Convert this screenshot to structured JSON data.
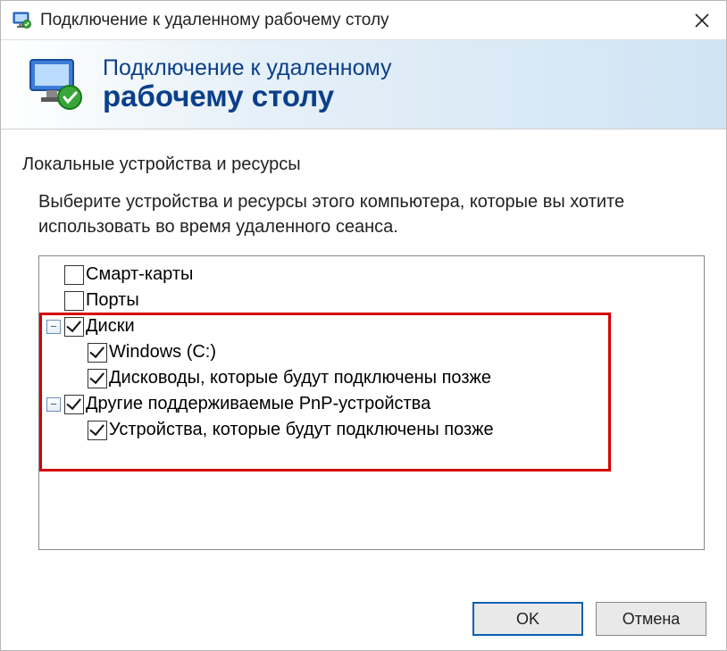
{
  "titlebar": {
    "title": "Подключение к удаленному рабочему столу"
  },
  "banner": {
    "line1": "Подключение к удаленному",
    "line2": "рабочему столу"
  },
  "section": {
    "title": "Локальные устройства и ресурсы",
    "desc": "Выберите устройства и ресурсы этого компьютера, которые вы хотите использовать во время удаленного сеанса."
  },
  "tree": {
    "items": [
      {
        "label": "Смарт-карты",
        "checked": false,
        "level": 1,
        "expander": null
      },
      {
        "label": "Порты",
        "checked": false,
        "level": 1,
        "expander": null
      },
      {
        "label": "Диски",
        "checked": true,
        "level": 1,
        "expander": "minus"
      },
      {
        "label": "Windows (C:)",
        "checked": true,
        "level": 2,
        "expander": null
      },
      {
        "label": "Дисководы, которые будут подключены позже",
        "checked": true,
        "level": 2,
        "expander": null
      },
      {
        "label": "Другие поддерживаемые PnP-устройства",
        "checked": true,
        "level": 1,
        "expander": "minus"
      },
      {
        "label": "Устройства, которые будут подключены позже",
        "checked": true,
        "level": 2,
        "expander": null
      }
    ]
  },
  "buttons": {
    "ok": "OK",
    "cancel": "Отмена"
  }
}
